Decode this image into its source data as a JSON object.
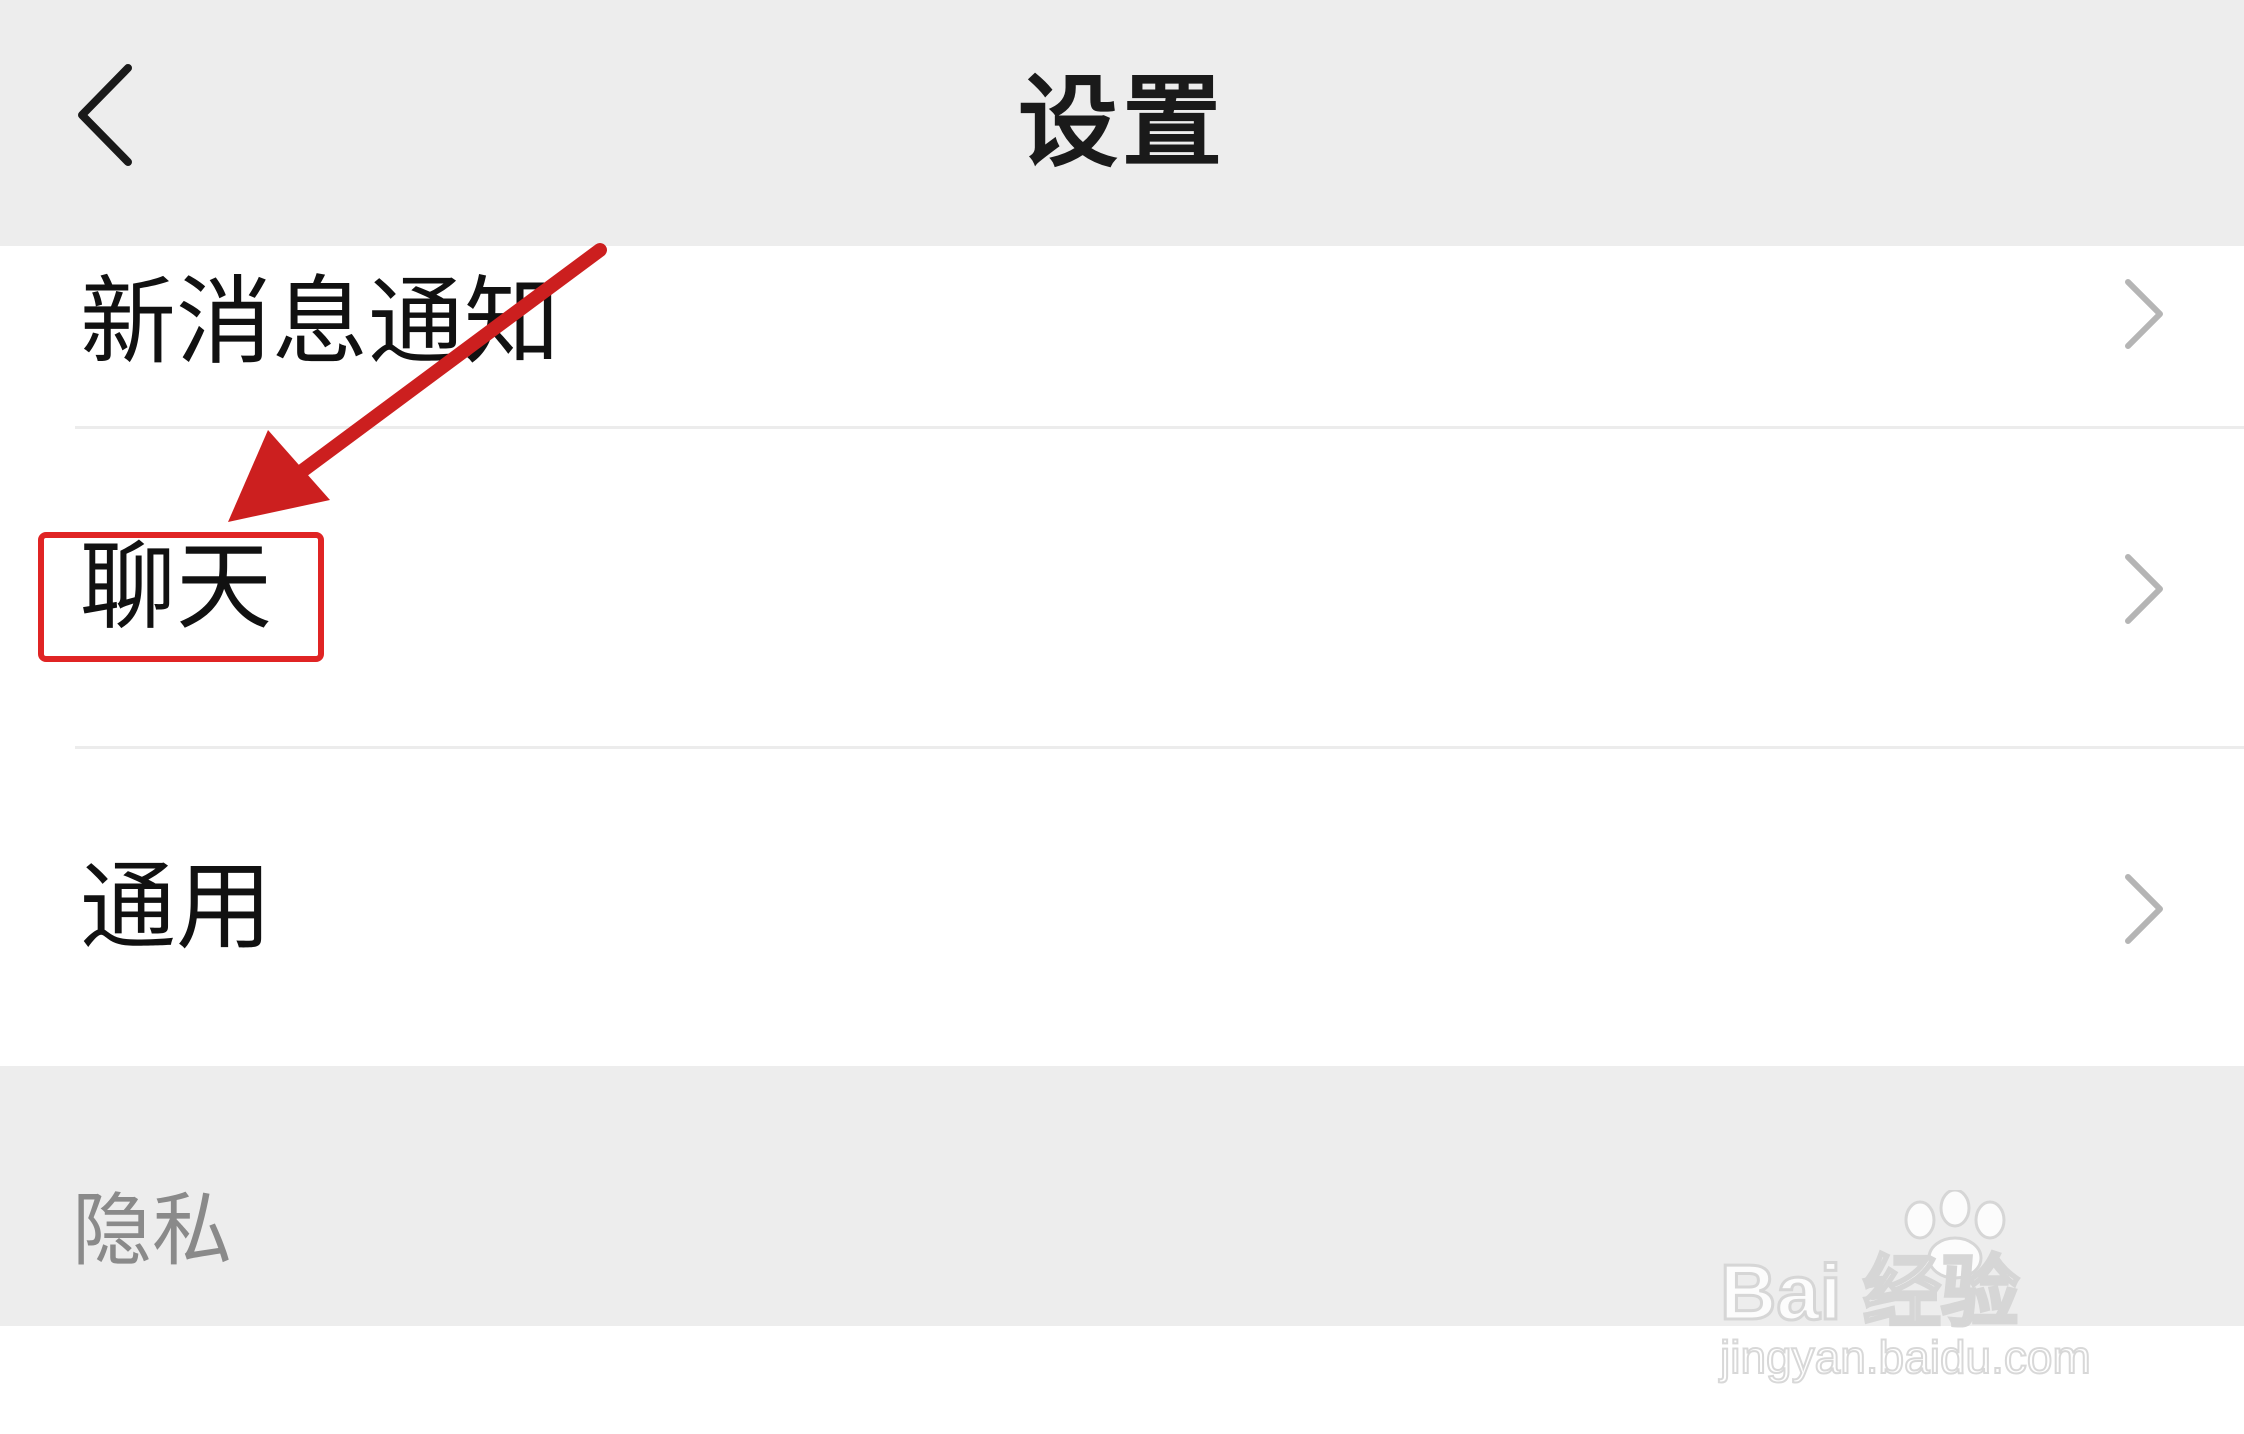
{
  "header": {
    "title": "设置",
    "back_icon": "chevron-left-icon"
  },
  "settings": {
    "items": [
      {
        "label": "新消息通知",
        "chevron": "chevron-right-icon"
      },
      {
        "label": "聊天",
        "chevron": "chevron-right-icon",
        "highlighted": true
      },
      {
        "label": "通用",
        "chevron": "chevron-right-icon"
      }
    ]
  },
  "section": {
    "title": "隐私"
  },
  "annotation": {
    "color": "#e02424",
    "arrow_target": "聊天"
  },
  "watermark": {
    "brand": "Bai 经验",
    "url": "jingyan.baidu.com"
  },
  "colors": {
    "header_bg": "#ededed",
    "list_bg": "#ffffff",
    "divider": "#ececec",
    "text": "#111111",
    "muted_text": "#8a8a8a",
    "chevron": "#b5b5b5"
  }
}
